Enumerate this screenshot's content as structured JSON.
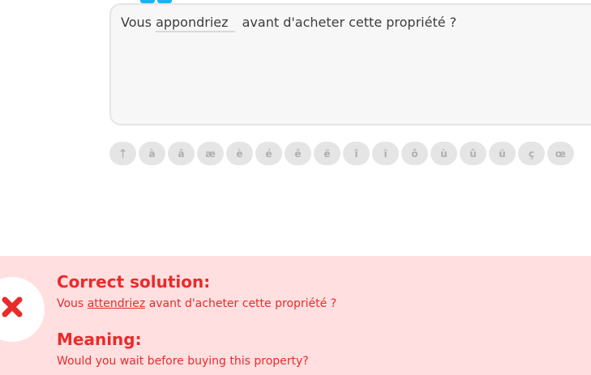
{
  "answer": {
    "prefix": "Vous",
    "typed": "appondriez",
    "suffix": "avant d'acheter cette propriété ?"
  },
  "special_chars": [
    "↑",
    "à",
    "â",
    "æ",
    "è",
    "é",
    "ê",
    "ë",
    "î",
    "ï",
    "ô",
    "ù",
    "û",
    "ü",
    "ç",
    "œ"
  ],
  "feedback": {
    "correct_title": "Correct solution:",
    "solution_prefix": "Vous",
    "solution_word": "attendriez",
    "solution_suffix": "avant d'acheter cette propriété ?",
    "meaning_title": "Meaning:",
    "meaning_text": "Would you wait before buying this property?"
  },
  "colors": {
    "error_red": "#ea2b2b",
    "error_bg": "#ffdfe0",
    "accent_blue": "#1cb0f6"
  }
}
